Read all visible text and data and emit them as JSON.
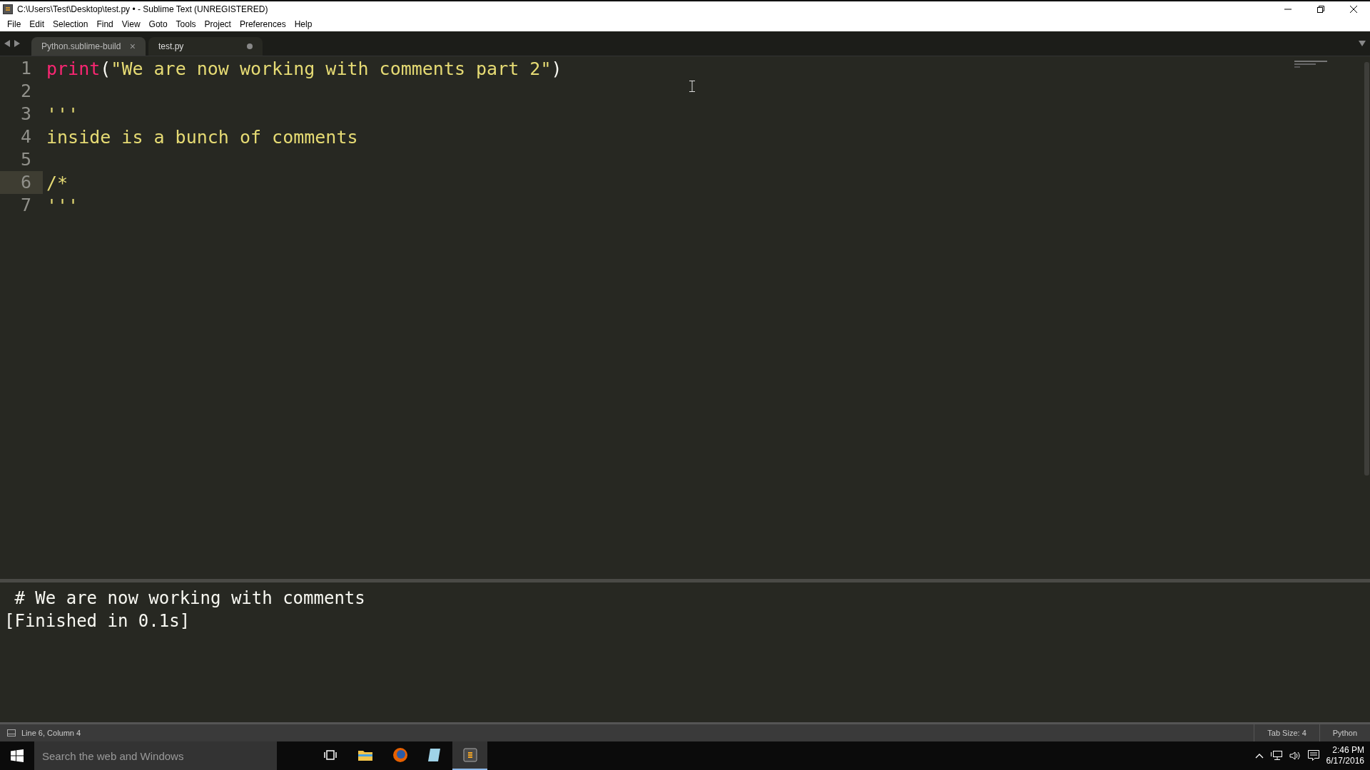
{
  "window": {
    "title": "C:\\Users\\Test\\Desktop\\test.py • - Sublime Text (UNREGISTERED)"
  },
  "menu": [
    "File",
    "Edit",
    "Selection",
    "Find",
    "View",
    "Goto",
    "Tools",
    "Project",
    "Preferences",
    "Help"
  ],
  "tabs": [
    {
      "label": "Python.sublime-build",
      "selected": false,
      "modified": false,
      "close": "×"
    },
    {
      "label": "test.py",
      "selected": true,
      "modified": true
    }
  ],
  "editor": {
    "lines": [
      {
        "number": "1",
        "current": false,
        "tokens": [
          {
            "kind": "keyword",
            "text": "print"
          },
          {
            "kind": "plain",
            "text": "("
          },
          {
            "kind": "string",
            "text": "\"We are now working with comments part 2\""
          },
          {
            "kind": "plain",
            "text": ")"
          }
        ]
      },
      {
        "number": "2",
        "current": false
      },
      {
        "number": "3",
        "current": false,
        "tokens": [
          {
            "kind": "string",
            "text": "'''"
          }
        ]
      },
      {
        "number": "4",
        "current": false,
        "tokens": [
          {
            "kind": "string",
            "text": "inside is a bunch of comments"
          }
        ]
      },
      {
        "number": "5",
        "current": false
      },
      {
        "number": "6",
        "current": true,
        "tokens": [
          {
            "kind": "string",
            "text": "/*"
          }
        ]
      },
      {
        "number": "7",
        "current": false,
        "tokens": [
          {
            "kind": "string",
            "text": "'''"
          }
        ]
      }
    ]
  },
  "output": {
    "lines": [
      " # We are now working with comments",
      "[Finished in 0.1s]"
    ]
  },
  "status_bar": {
    "position": "Line 6, Column 4",
    "tab_size": "Tab Size: 4",
    "syntax": "Python"
  },
  "taskbar": {
    "search": {
      "placeholder": "Search the web and Windows"
    },
    "apps": [
      {
        "kind": "taskview",
        "selected": false
      },
      {
        "kind": "folder",
        "selected": false
      },
      {
        "kind": "browser",
        "selected": false
      },
      {
        "kind": "notepad",
        "selected": false
      },
      {
        "kind": "editor",
        "selected": true
      }
    ],
    "time": "2:46 PM",
    "date": "6/17/2016"
  }
}
